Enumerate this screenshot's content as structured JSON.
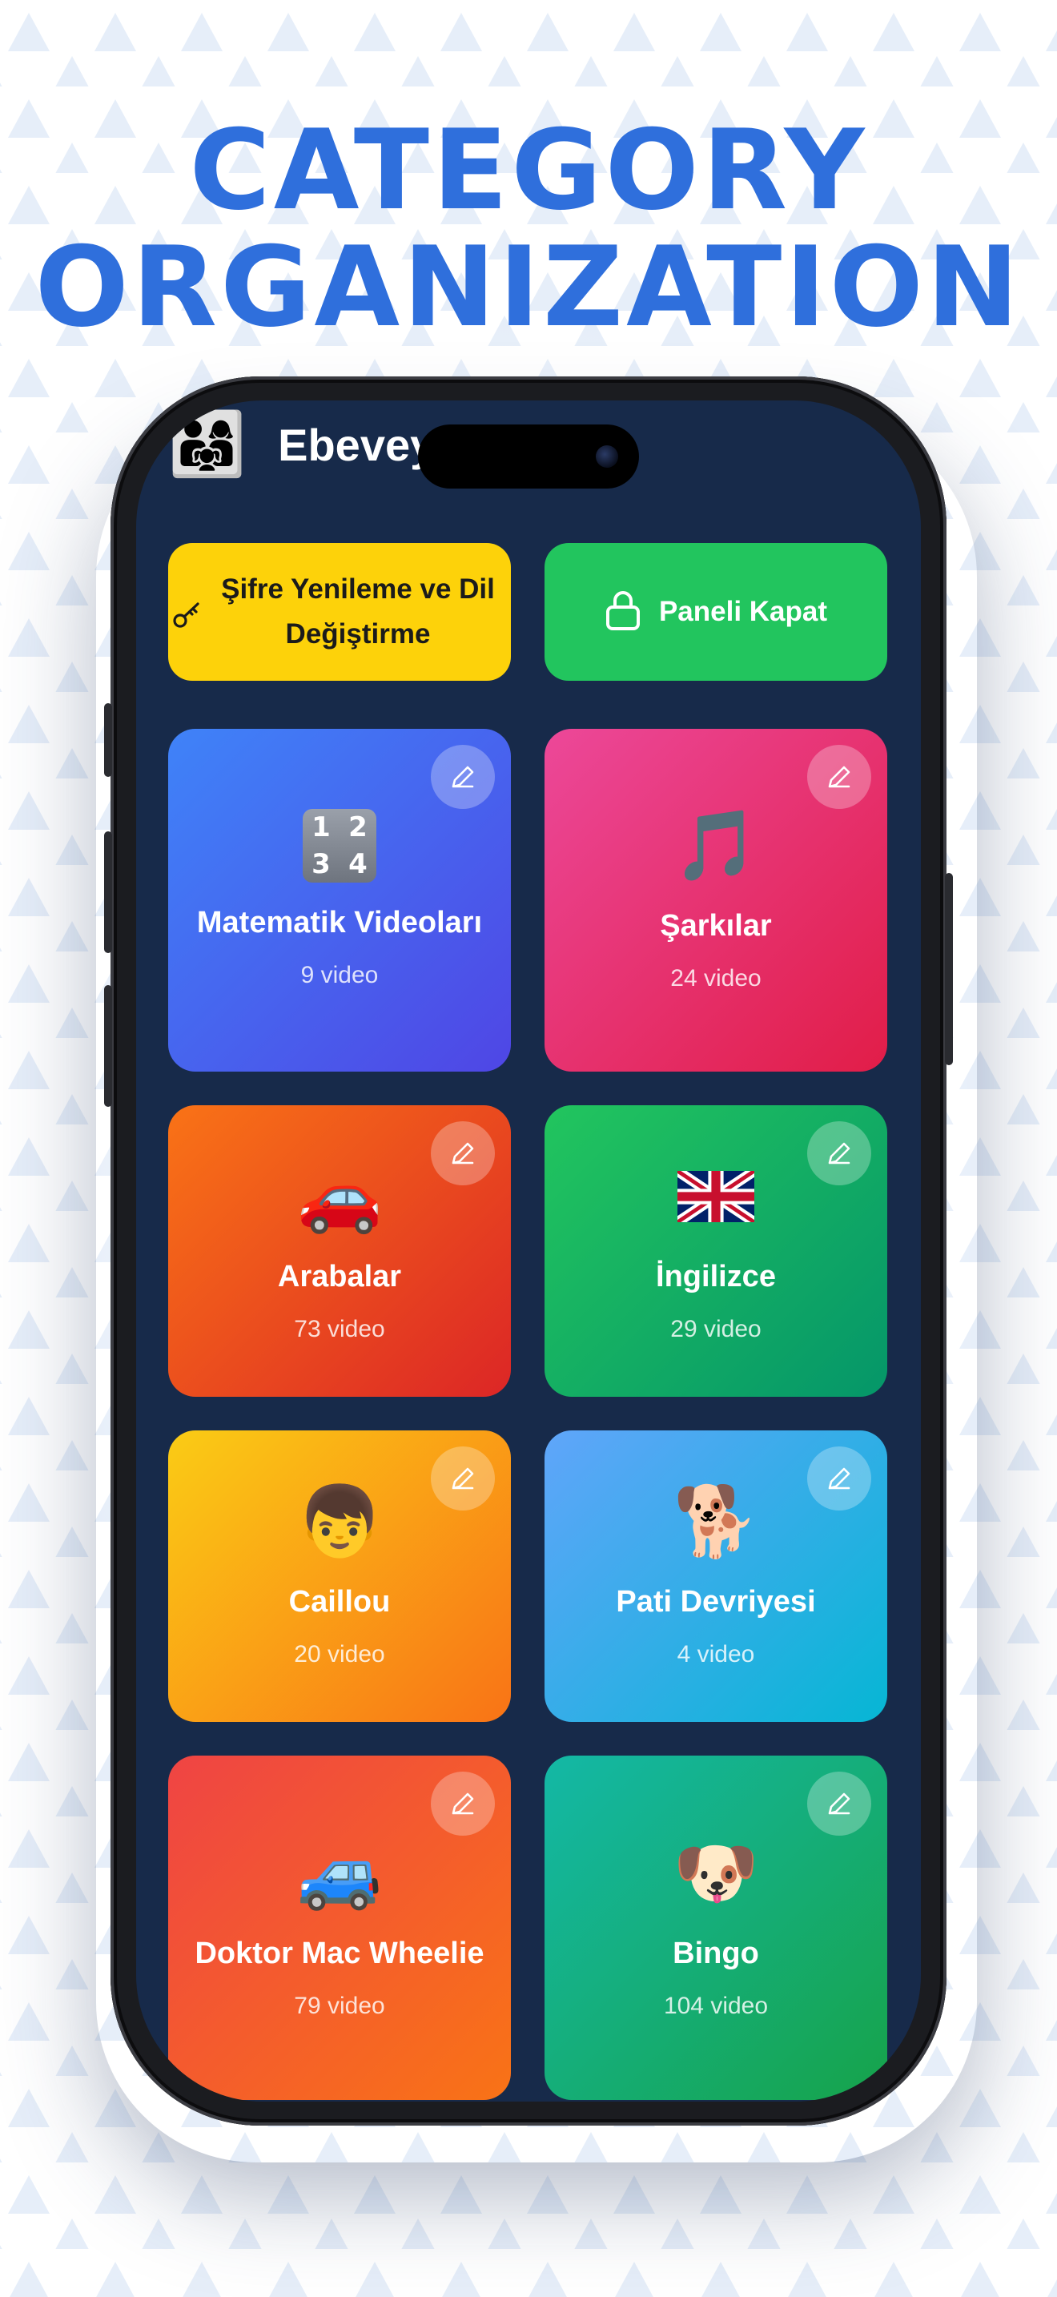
{
  "headline": {
    "line1": "CATEGORY",
    "line2": "ORGANIZATION"
  },
  "app": {
    "title": "Ebeveyn Paneli",
    "avatar_emoji": "👨‍👩‍👧",
    "reset_button_label": "Şifre Yenileme ve Dil Değiştirme",
    "close_button_label": "Paneli Kapat"
  },
  "categories": [
    {
      "name": "Matematik Videoları",
      "count": "9 video",
      "icon": "1234"
    },
    {
      "name": "Şarkılar",
      "count": "24 video",
      "icon": "🎵"
    },
    {
      "name": "Arabalar",
      "count": "73 video",
      "icon": "🚗"
    },
    {
      "name": "İngilizce",
      "count": "29 video",
      "icon": "🇬🇧"
    },
    {
      "name": "Caillou",
      "count": "20 video",
      "icon": "👦"
    },
    {
      "name": "Pati Devriyesi",
      "count": "4 video",
      "icon": "🐕"
    },
    {
      "name": "Doktor Mac Wheelie",
      "count": "79 video",
      "icon": "🚙"
    },
    {
      "name": "Bingo",
      "count": "104 video",
      "icon": "🐶"
    }
  ],
  "colors": {
    "headline": "#2f6fdc",
    "screen_background": "#172a4a",
    "reset_button": "#fdd20a",
    "close_button": "#22c55e"
  }
}
